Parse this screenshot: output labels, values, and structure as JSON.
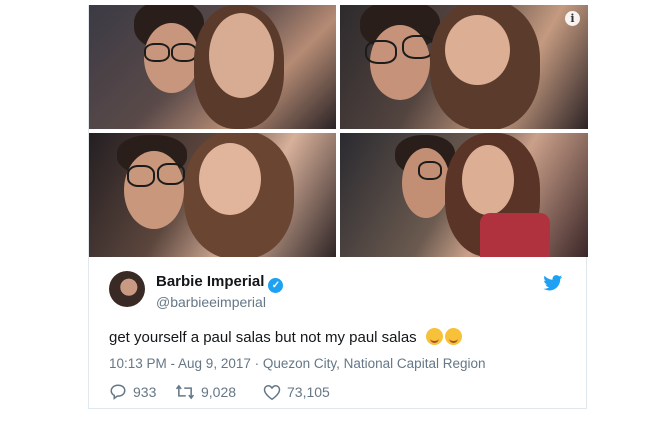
{
  "tweet": {
    "author_name": "Barbie Imperial",
    "author_handle": "@barbieeimperial",
    "text": "get yourself a paul salas but not my paul salas",
    "timestamp": "10:13 PM - Aug 9, 2017",
    "separator": " · ",
    "location": "Quezon City, National Capital Region",
    "replies": "933",
    "retweets": "9,028",
    "likes": "73,105"
  },
  "icons": {
    "info": "info-icon",
    "verified": "verified-badge-icon",
    "brand": "twitter-bird-icon",
    "reply": "reply-icon",
    "retweet": "retweet-icon",
    "like": "heart-icon",
    "emoji1": "face-savoring-food-emoji",
    "emoji2": "smiling-face-with-hearts-emoji"
  },
  "colors": {
    "brand_blue": "#1da1f2",
    "text_primary": "#14171a",
    "text_secondary": "#657786"
  }
}
